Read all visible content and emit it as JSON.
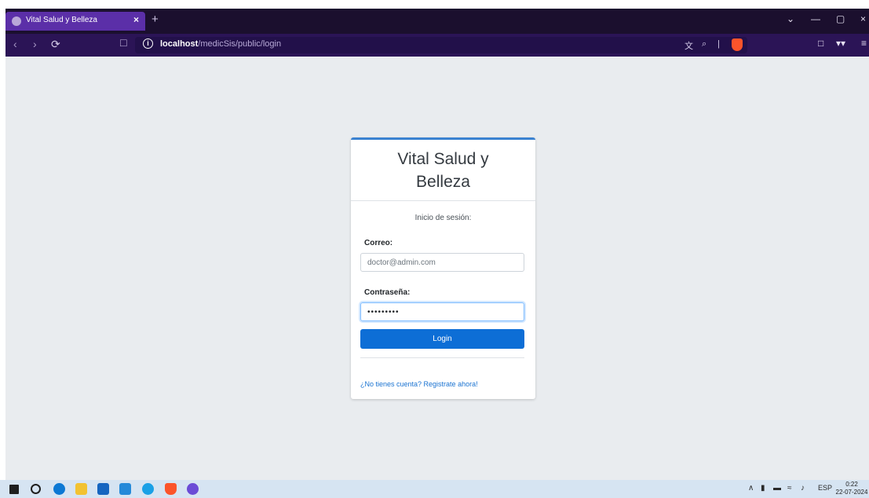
{
  "browser": {
    "tab_title": "Vital Salud y Belleza",
    "tab_close": "×",
    "new_tab": "+",
    "url_host": "localhost",
    "url_path": "/medicSis/public/login",
    "window_controls": {
      "minimize": "—",
      "maximize": "▢",
      "close": "×"
    }
  },
  "icons": {
    "back": "back-icon",
    "forward": "forward-icon",
    "reload": "reload-icon",
    "bookmark": "bookmark-icon",
    "info": "info-icon",
    "translate": "translate-icon",
    "zoom": "zoom-icon",
    "brave_shield": "brave-shield-icon",
    "sidebar": "sidebar-icon",
    "wallet": "glasses-icon",
    "menu": "menu-icon"
  },
  "login": {
    "brand_line1": "Vital Salud y",
    "brand_line2": "Belleza",
    "subtitle": "Inicio de sesión:",
    "email_label": "Correo:",
    "email_placeholder": "doctor@admin.com",
    "password_label": "Contraseña:",
    "password_value": "•••••••••",
    "login_button": "Login",
    "register_link": "¿No tienes cuenta? Registrate ahora!"
  },
  "taskbar": {
    "language": "ESP",
    "time": "0:22",
    "date": "22-07-2024"
  },
  "colors": {
    "tab_active": "#5b2fa8",
    "toolbar": "#2b1456",
    "viewport_bg": "#e9ecef",
    "card_border_top": "#3b82d1",
    "button_primary": "#0d6ed6",
    "link": "#1a73d1"
  }
}
